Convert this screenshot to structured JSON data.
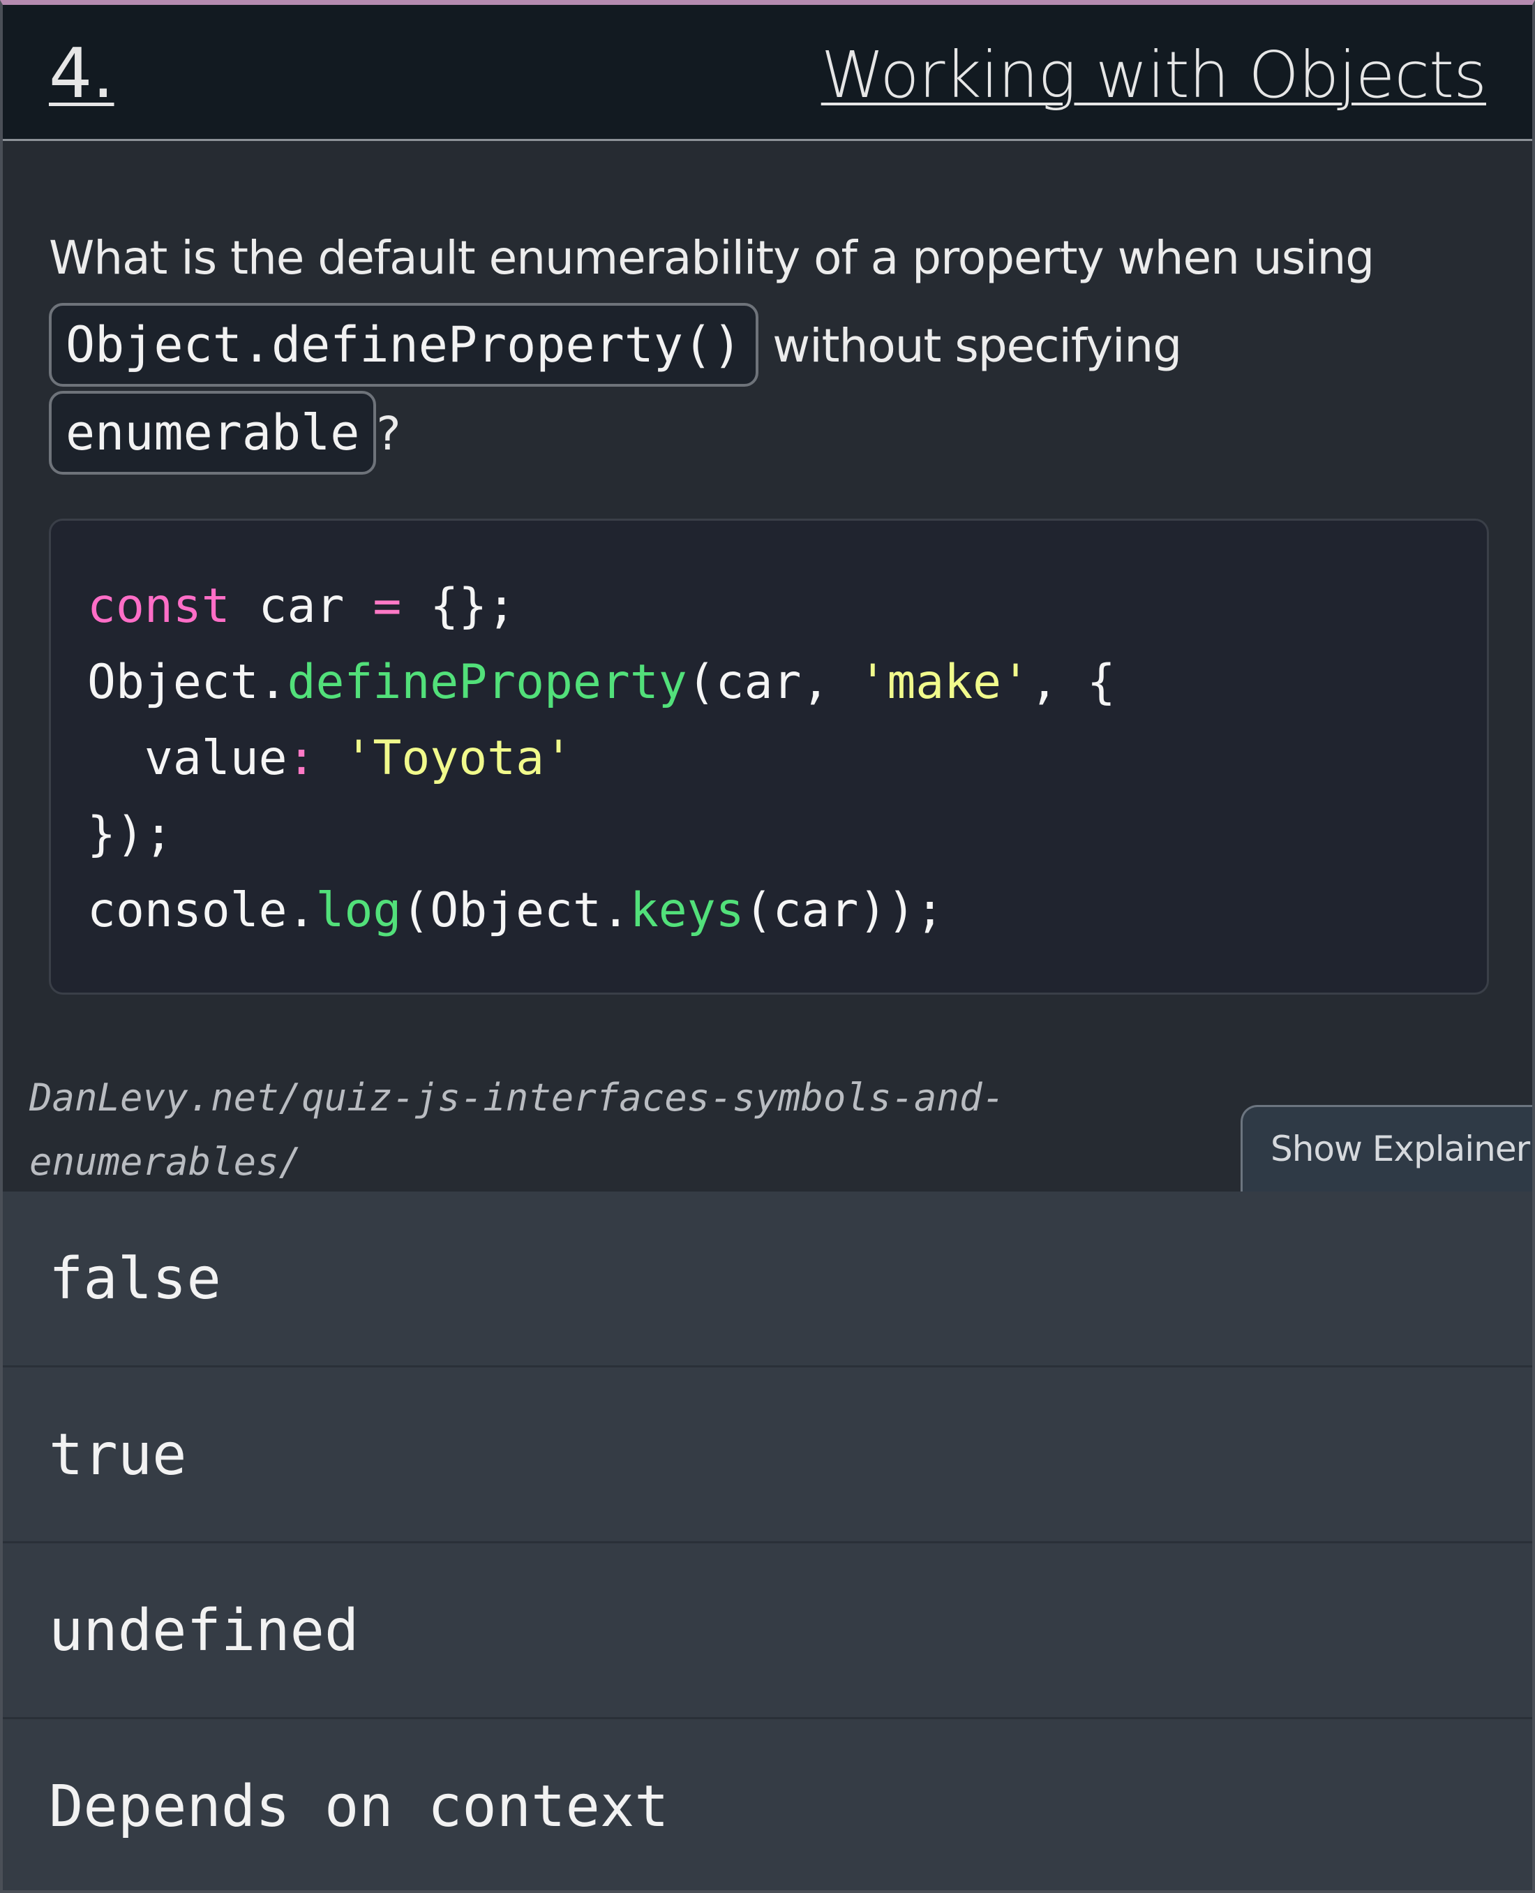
{
  "header": {
    "number": "4.",
    "title": "Working with Objects"
  },
  "question": {
    "text_before": "What is the default enumerability of a property when using",
    "code_1": "Object.defineProperty()",
    "text_middle": "without specifying",
    "code_2": "enumerable",
    "text_after": "?"
  },
  "code_block": {
    "lines": [
      "const car = {};",
      "Object.defineProperty(car, 'make', {",
      "  value: 'Toyota'",
      "});",
      "console.log(Object.keys(car));"
    ]
  },
  "source": {
    "url": "DanLevy.net/quiz-js-interfaces-symbols-and-enumerables/"
  },
  "explainer_button": {
    "label": "Show Explainer"
  },
  "answers": [
    {
      "label": "false"
    },
    {
      "label": "true"
    },
    {
      "label": "undefined"
    },
    {
      "label": "Depends on context"
    }
  ],
  "colors": {
    "keyword": "#ff6ec7",
    "function": "#52e07a",
    "string": "#f1fa8c",
    "background": "#262b32",
    "header_bg": "#121a21"
  }
}
